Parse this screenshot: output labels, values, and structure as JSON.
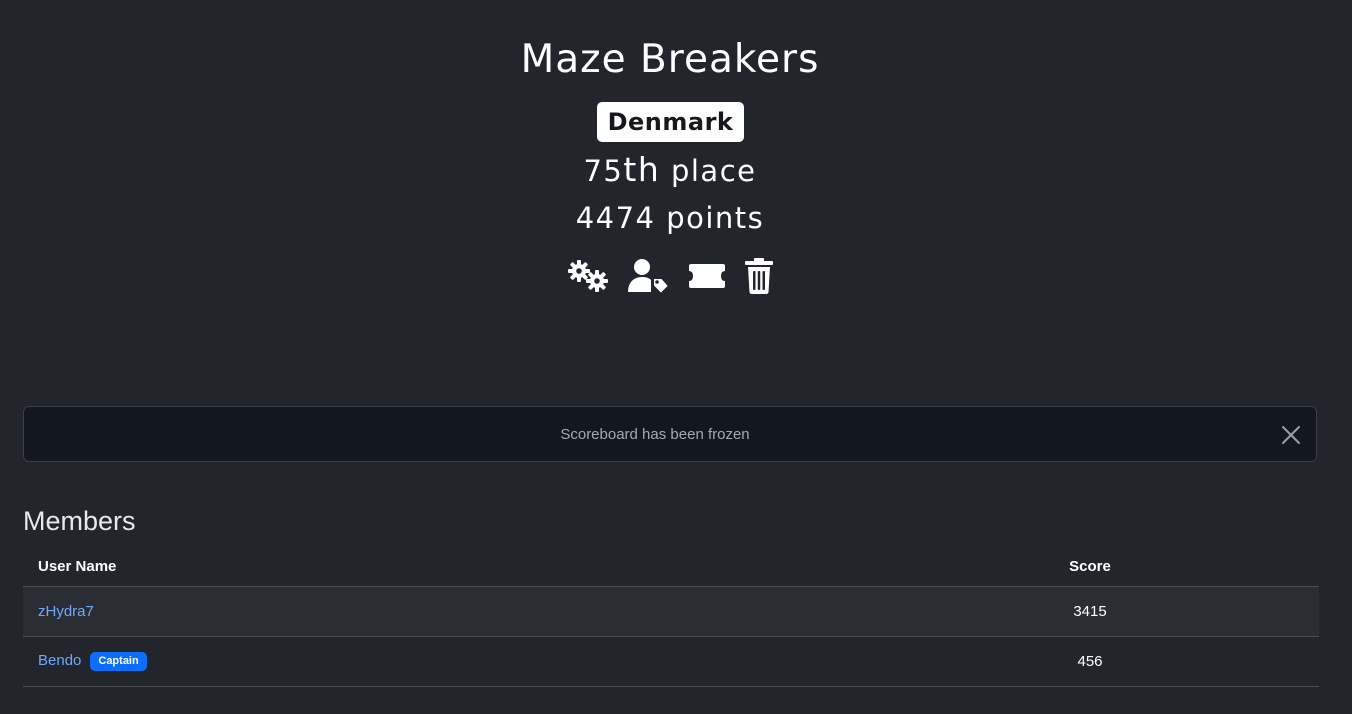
{
  "team": {
    "name": "Maze Breakers",
    "country": "Denmark",
    "place_number": "75",
    "place_ordinal": "th",
    "place_word": "place",
    "points_value": "4474",
    "points_word": "points"
  },
  "actions": [
    {
      "icon": "gears-icon"
    },
    {
      "icon": "user-tag-icon"
    },
    {
      "icon": "ticket-icon"
    },
    {
      "icon": "trash-icon"
    }
  ],
  "alert": {
    "message": "Scoreboard has been frozen",
    "close_icon": "close-icon"
  },
  "members": {
    "title": "Members",
    "columns": {
      "user_name": "User Name",
      "score": "Score"
    },
    "rows": [
      {
        "name": "zHydra7",
        "score": "3415",
        "badge": ""
      },
      {
        "name": "Bendo",
        "score": "456",
        "badge": "Captain"
      }
    ]
  },
  "colors": {
    "background": "#22252b",
    "link": "#6ea8fe",
    "badge": "#0d6efd",
    "alert_bg": "#131820"
  }
}
